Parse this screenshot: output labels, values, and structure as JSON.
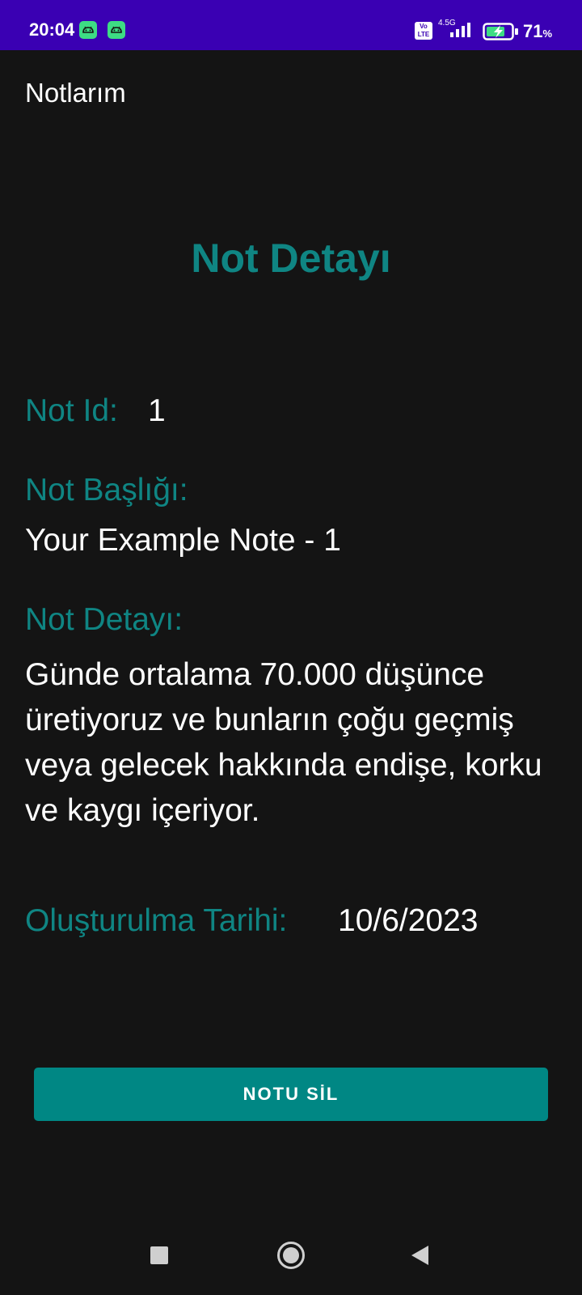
{
  "status_bar": {
    "time": "20:04",
    "volte_line1": "Vo",
    "volte_line2": "LTE",
    "network": "4.5G",
    "battery_percent": "71",
    "battery_unit": "%",
    "icons": [
      "android-app-icon",
      "android-app-icon",
      "volte-icon",
      "signal-icon",
      "battery-charging-icon"
    ]
  },
  "app_bar": {
    "title": "Notlarım"
  },
  "page": {
    "heading": "Not Detayı",
    "id_label": "Not Id:",
    "id_value": "1",
    "title_label": "Not Başlığı:",
    "title_value": "Your Example Note - 1",
    "detail_label": "Not Detayı:",
    "detail_value": "Günde ortalama 70.000 düşünce üretiyoruz ve bunların çoğu geçmiş veya gelecek hakkında endişe, korku ve kaygı içeriyor.",
    "date_label": "Oluşturulma Tarihi:",
    "date_value": "10/6/2023"
  },
  "actions": {
    "delete_label": "NOTU SİL"
  },
  "colors": {
    "status_bar": "#3a00b3",
    "background": "#141414",
    "accent": "#0f8583",
    "button": "#008784",
    "text": "#ffffff"
  },
  "nav_bar": {
    "icons": [
      "recent-apps-icon",
      "home-icon",
      "back-icon"
    ]
  }
}
